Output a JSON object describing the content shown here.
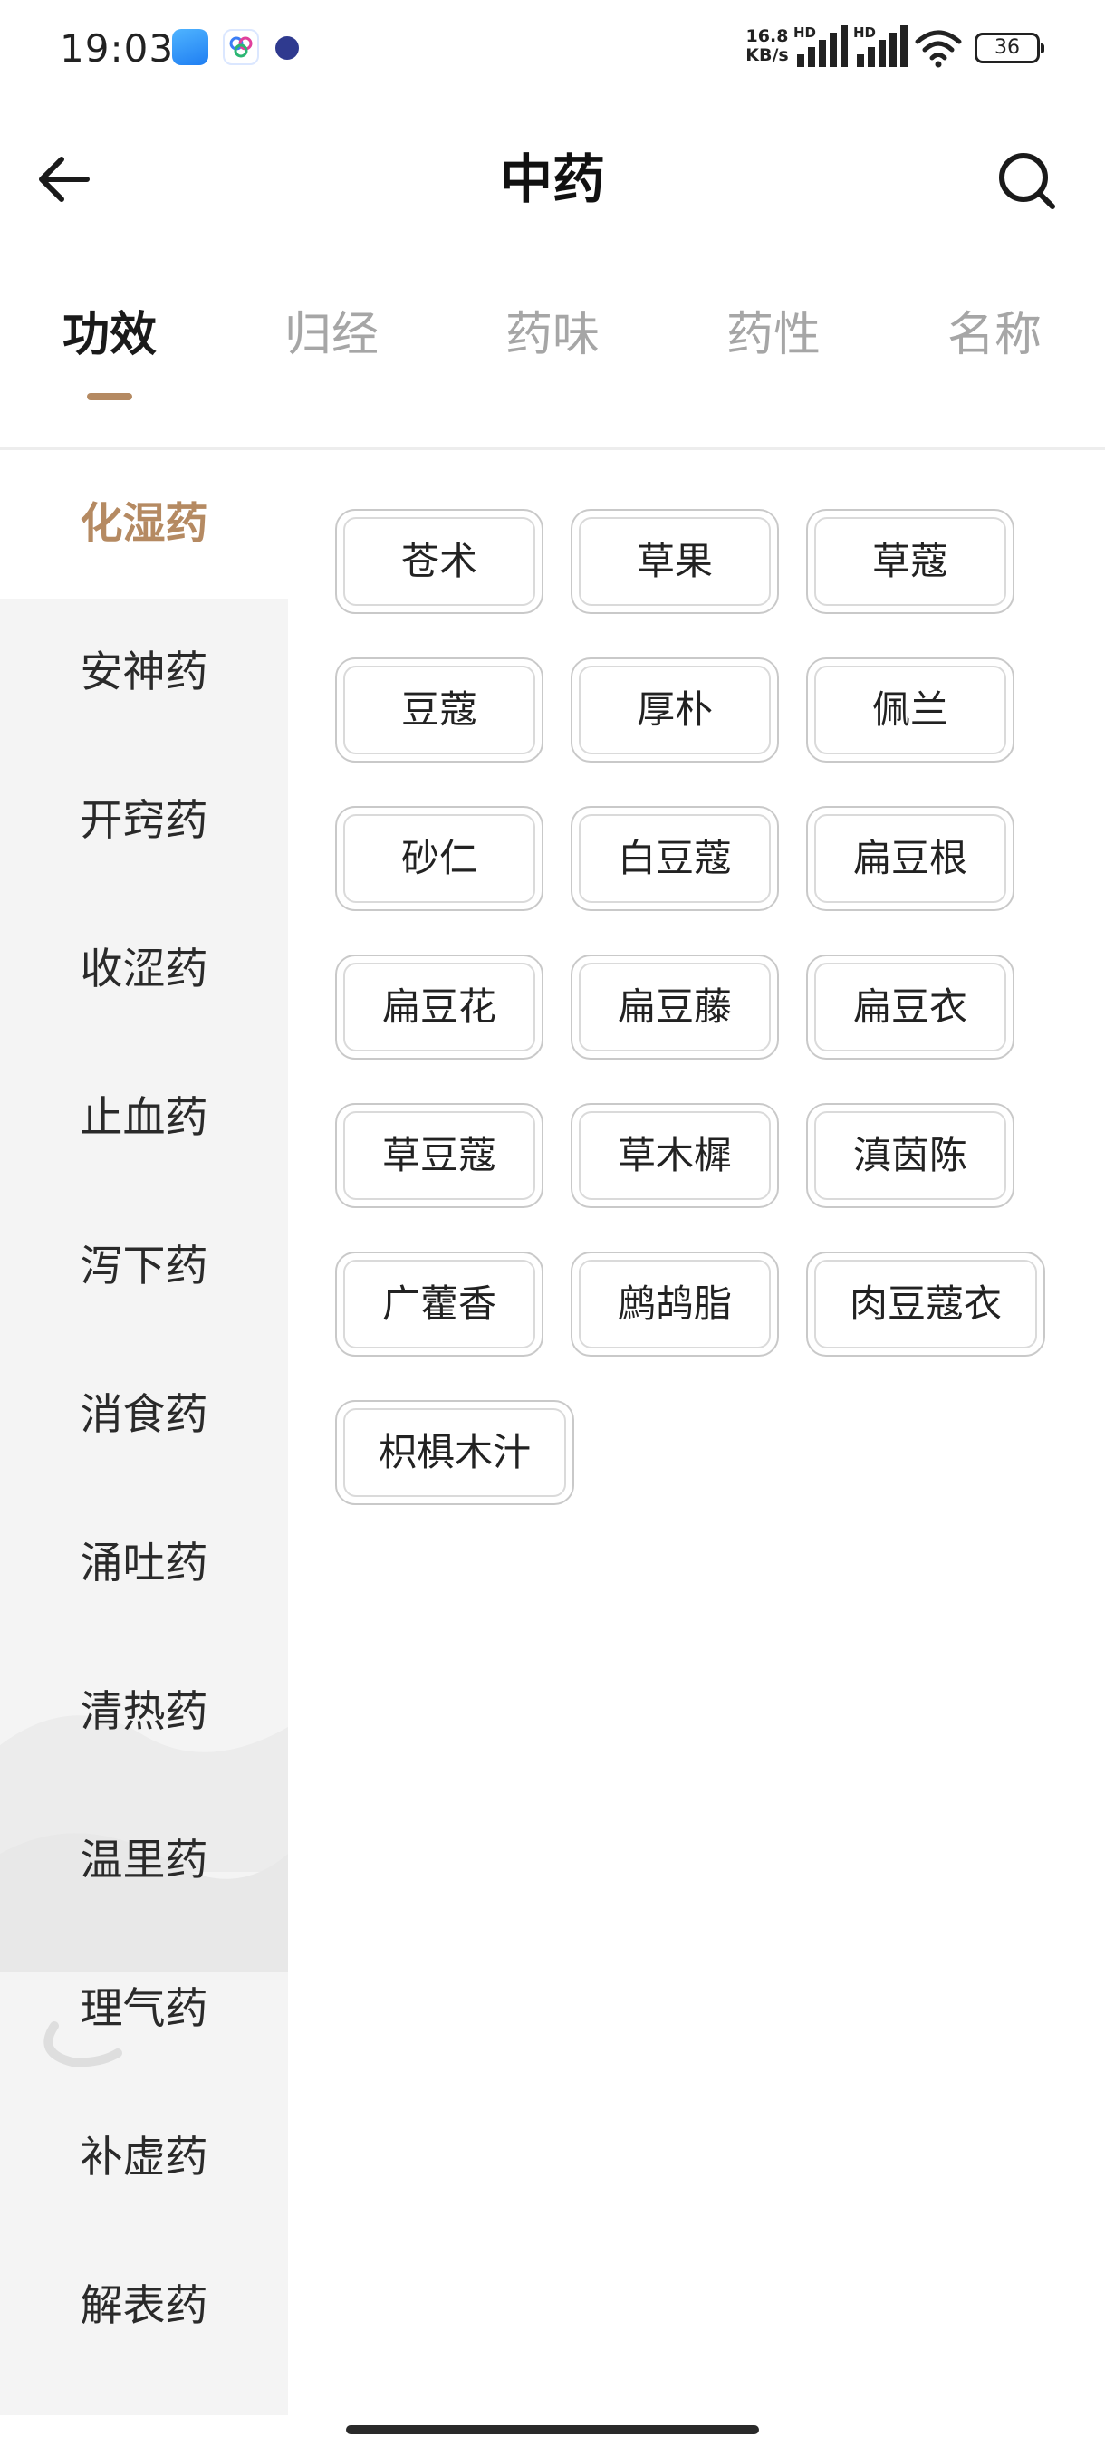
{
  "status_bar": {
    "time": "19:03",
    "net_speed_value": "16.8",
    "net_speed_unit": "KB/s",
    "signal1_label": "HD",
    "signal2_label": "HD",
    "battery": "36"
  },
  "header": {
    "title": "中药"
  },
  "tabs": [
    {
      "label": "功效",
      "active": true
    },
    {
      "label": "归经",
      "active": false
    },
    {
      "label": "药味",
      "active": false
    },
    {
      "label": "药性",
      "active": false
    },
    {
      "label": "名称",
      "active": false
    }
  ],
  "sidebar": {
    "items": [
      {
        "label": "化湿药",
        "active": true
      },
      {
        "label": "安神药",
        "active": false
      },
      {
        "label": "开窍药",
        "active": false
      },
      {
        "label": "收涩药",
        "active": false
      },
      {
        "label": "止血药",
        "active": false
      },
      {
        "label": "泻下药",
        "active": false
      },
      {
        "label": "消食药",
        "active": false
      },
      {
        "label": "涌吐药",
        "active": false
      },
      {
        "label": "清热药",
        "active": false
      },
      {
        "label": "温里药",
        "active": false
      },
      {
        "label": "理气药",
        "active": false
      },
      {
        "label": "补虚药",
        "active": false
      },
      {
        "label": "解表药",
        "active": false
      }
    ]
  },
  "herbs": [
    "苍术",
    "草果",
    "草蔻",
    "豆蔻",
    "厚朴",
    "佩兰",
    "砂仁",
    "白豆蔻",
    "扁豆根",
    "扁豆花",
    "扁豆藤",
    "扁豆衣",
    "草豆蔻",
    "草木樨",
    "滇茵陈",
    "广藿香",
    "鹧鸪脂",
    "肉豆蔻衣",
    "枳椇木汁"
  ],
  "colors": {
    "accent": "#b58a62",
    "sidebar_bg": "#f4f4f4",
    "inactive_text": "#a6a6a6",
    "chip_border": "#c9c9c9"
  }
}
